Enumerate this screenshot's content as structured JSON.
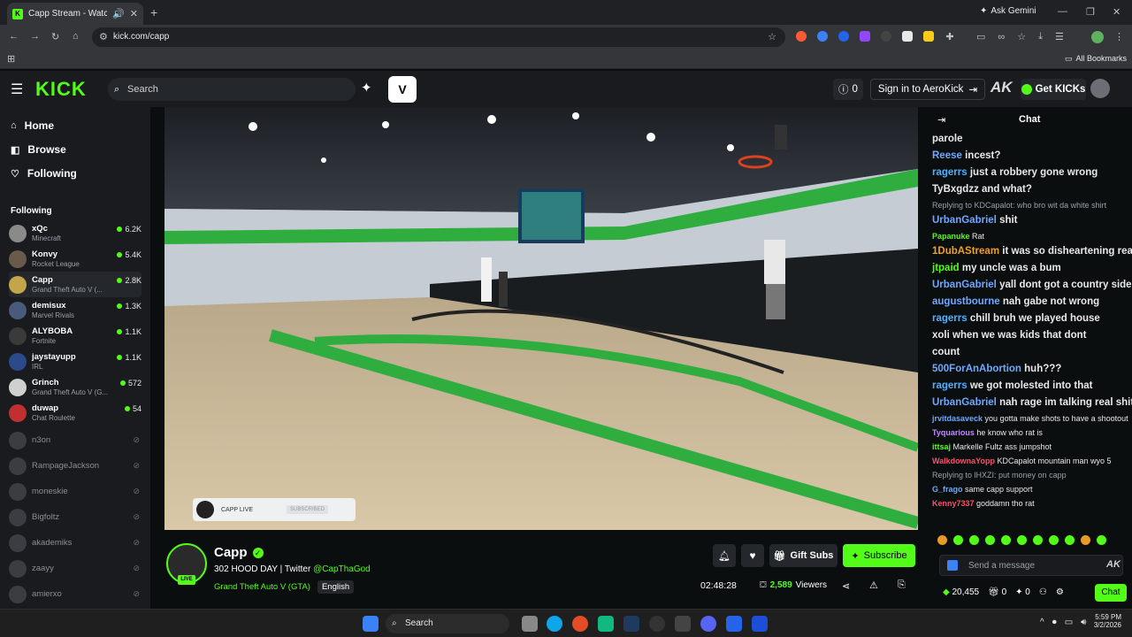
{
  "browser": {
    "tab_title": "Capp Stream - Watch Live ...",
    "url": "kick.com/capp",
    "ask_gemini": "Ask Gemini",
    "all_bookmarks": "All Bookmarks"
  },
  "header": {
    "logo": "KICK",
    "search_placeholder": "Search",
    "notif_count": "0",
    "sign_in": "Sign in to AeroKick",
    "get_kicks": "Get KICKs"
  },
  "sidebar": {
    "nav": [
      {
        "label": "Home",
        "icon": "home-icon"
      },
      {
        "label": "Browse",
        "icon": "browse-icon"
      },
      {
        "label": "Following",
        "icon": "heart-icon"
      }
    ],
    "following_header": "Following",
    "live": [
      {
        "name": "xQc",
        "game": "Minecraft",
        "viewers": "6.2K"
      },
      {
        "name": "Konvy",
        "game": "Rocket League",
        "viewers": "5.4K"
      },
      {
        "name": "Capp",
        "game": "Grand Theft Auto V (...",
        "viewers": "2.8K"
      },
      {
        "name": "demisux",
        "game": "Marvel Rivals",
        "viewers": "1.3K"
      },
      {
        "name": "ALYBOBA",
        "game": "Fortnite",
        "viewers": "1.1K"
      },
      {
        "name": "jaystayupp",
        "game": "IRL",
        "viewers": "1.1K"
      },
      {
        "name": "Grinch",
        "game": "Grand Theft Auto V (G...",
        "viewers": "572"
      },
      {
        "name": "duwap",
        "game": "Chat Roulette",
        "viewers": "54"
      }
    ],
    "offline": [
      "n3on",
      "RampageJackson",
      "moneskie",
      "Bigfoltz",
      "akademiks",
      "zaayy",
      "amierxo"
    ]
  },
  "overlay": {
    "label": "CAPP LIVE",
    "button": "SUBSCRIBED"
  },
  "stream": {
    "channel": "Capp",
    "title": "302 HOOD DAY | Twitter",
    "twitter": "@CapThaGod",
    "category": "Grand Theft Auto V (GTA)",
    "language": "English",
    "uptime": "02:48:28",
    "viewers": "2,589",
    "viewers_label": "Viewers",
    "gift_subs": "Gift Subs",
    "subscribe": "Subscribe",
    "live_badge": "LIVE"
  },
  "chat": {
    "title": "Chat",
    "placeholder": "Send a message",
    "send_label": "Chat",
    "points": "20,455",
    "count_a": "0",
    "count_b": "0",
    "lines": [
      {
        "user": "",
        "color": "#e8e8e8",
        "text": "parole",
        "big": true
      },
      {
        "user": "Reese",
        "color": "#6ea8ff",
        "text": "incest?",
        "big": true
      },
      {
        "user": "ragerrs",
        "color": "#4fb0ff",
        "text": "just a robbery gone wrong",
        "big": true
      },
      {
        "user": "TyBxgdzz",
        "color": "#e8e8e8",
        "text": "and what?",
        "big": true
      },
      {
        "user": "",
        "color": "#9aa0a6",
        "text": "Replying to KDCapalot: who bro wit da white shirt",
        "big": false
      },
      {
        "user": "UrbanGabriel",
        "color": "#6ea8ff",
        "text": "shit",
        "big": true
      },
      {
        "user": "Papanuke",
        "color": "#53fc18",
        "text": "Rat",
        "big": false
      },
      {
        "user": "1DubAStream",
        "color": "#f0a020",
        "text": "it was so disheartening realizing",
        "big": true
      },
      {
        "user": "jtpaid",
        "color": "#53fc18",
        "text": "my uncle was a bum",
        "big": true
      },
      {
        "user": "UrbanGabriel",
        "color": "#6ea8ff",
        "text": "yall dont got a country side",
        "big": true
      },
      {
        "user": "augustbourne",
        "color": "#6ea8ff",
        "text": "nah gabe not wrong",
        "big": true
      },
      {
        "user": "ragerrs",
        "color": "#4fb0ff",
        "text": "chill bruh we played house",
        "big": true
      },
      {
        "user": "xoli",
        "color": "#e8e8e8",
        "text": "when we was kids that dont",
        "big": true
      },
      {
        "user": "",
        "color": "#e8e8e8",
        "text": "count",
        "big": true
      },
      {
        "user": "500ForAnAbortion",
        "color": "#6ea8ff",
        "text": "huh???",
        "big": true
      },
      {
        "user": "ragerrs",
        "color": "#4fb0ff",
        "text": "we got molested into that",
        "big": true
      },
      {
        "user": "UrbanGabriel",
        "color": "#6ea8ff",
        "text": "nah rage im talking real shit",
        "big": true
      },
      {
        "user": "jrvitdasaveck",
        "color": "#6ea8ff",
        "text": "you gotta make shots to have a shootout",
        "big": false
      },
      {
        "user": "Tyquarious",
        "color": "#c08cff",
        "text": "he know who rat is",
        "big": false
      },
      {
        "user": "ittsaj",
        "color": "#53fc18",
        "text": "Markelle Fultz ass jumpshot",
        "big": false
      },
      {
        "user": "WalkdownaYopp",
        "color": "#ff4d6d",
        "text": "KDCapalot mountain man wyo 5",
        "big": false
      },
      {
        "user": "",
        "color": "#9aa0a6",
        "text": "Replying to lHXZI: put money on capp",
        "big": false
      },
      {
        "user": "G_frago",
        "color": "#6ea8ff",
        "text": "same capp support",
        "big": false
      },
      {
        "user": "Kenny7337",
        "color": "#ff4d6d",
        "text": "goddamn tho rat",
        "big": false
      }
    ]
  },
  "taskbar": {
    "search": "Search",
    "time": "5:59 PM",
    "date": "3/2/2026"
  }
}
